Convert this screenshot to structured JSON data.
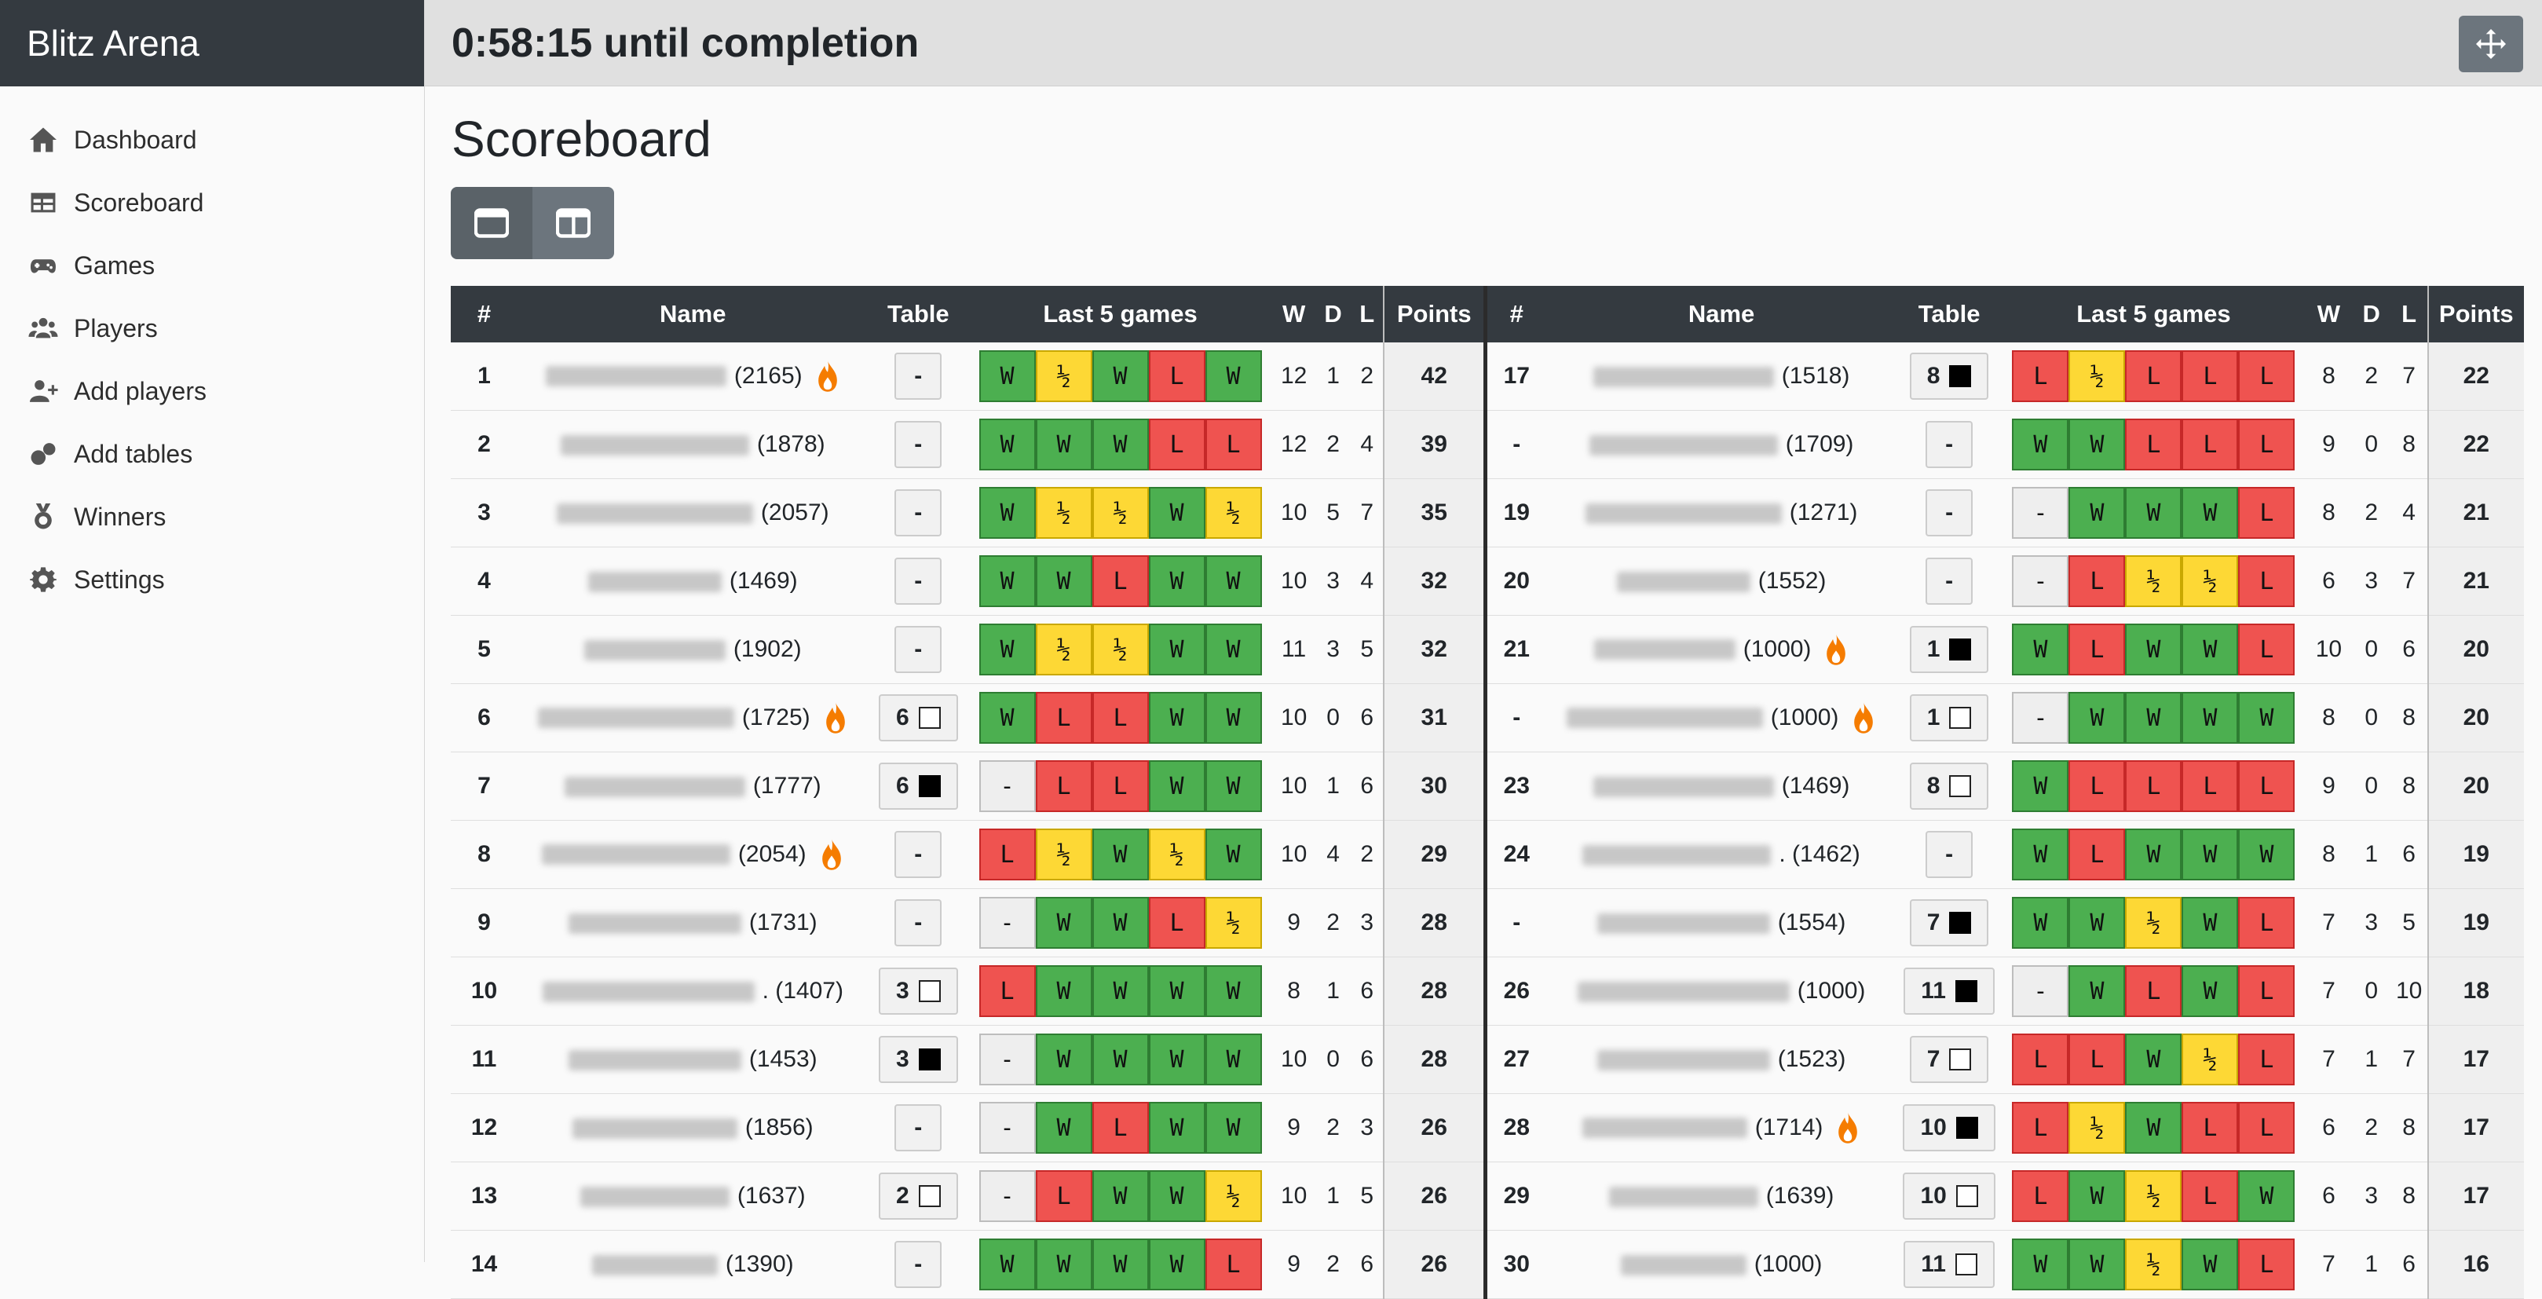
{
  "app": {
    "title": "Blitz Arena"
  },
  "sidebar": {
    "items": [
      {
        "label": "Dashboard",
        "icon": "home-icon"
      },
      {
        "label": "Scoreboard",
        "icon": "table-icon"
      },
      {
        "label": "Games",
        "icon": "gamepad-icon"
      },
      {
        "label": "Players",
        "icon": "users-icon"
      },
      {
        "label": "Add players",
        "icon": "user-plus-icon"
      },
      {
        "label": "Add tables",
        "icon": "tables-icon"
      },
      {
        "label": "Winners",
        "icon": "medal-icon"
      },
      {
        "label": "Settings",
        "icon": "gear-icon"
      }
    ]
  },
  "header": {
    "countdown": "0:58:15 until completion"
  },
  "main": {
    "title": "Scoreboard"
  },
  "columns": {
    "rank": "#",
    "name": "Name",
    "table": "Table",
    "last5": "Last 5 games",
    "w": "W",
    "d": "D",
    "l": "L",
    "points": "Points"
  },
  "colors": {
    "win": "#4caf50",
    "loss": "#ef5350",
    "draw": "#fdd835",
    "none": "#eeeeee",
    "header": "#343a40"
  },
  "standings_left": [
    {
      "rank": "1",
      "elo": "(2165)",
      "fire": true,
      "table": "-",
      "color": "",
      "games": [
        "W",
        "½",
        "W",
        "L",
        "W"
      ],
      "w": "12",
      "d": "1",
      "l": "2",
      "points": "42"
    },
    {
      "rank": "2",
      "elo": "(1878)",
      "fire": false,
      "table": "-",
      "color": "",
      "games": [
        "W",
        "W",
        "W",
        "L",
        "L"
      ],
      "w": "12",
      "d": "2",
      "l": "4",
      "points": "39"
    },
    {
      "rank": "3",
      "elo": "(2057)",
      "fire": false,
      "table": "-",
      "color": "",
      "games": [
        "W",
        "½",
        "½",
        "W",
        "½"
      ],
      "w": "10",
      "d": "5",
      "l": "7",
      "points": "35"
    },
    {
      "rank": "4",
      "elo": "(1469)",
      "fire": false,
      "table": "-",
      "color": "",
      "games": [
        "W",
        "W",
        "L",
        "W",
        "W"
      ],
      "w": "10",
      "d": "3",
      "l": "4",
      "points": "32"
    },
    {
      "rank": "5",
      "elo": "(1902)",
      "fire": false,
      "table": "-",
      "color": "",
      "games": [
        "W",
        "½",
        "½",
        "W",
        "W"
      ],
      "w": "11",
      "d": "3",
      "l": "5",
      "points": "32"
    },
    {
      "rank": "6",
      "elo": "(1725)",
      "fire": true,
      "table": "6",
      "color": "white",
      "games": [
        "W",
        "L",
        "L",
        "W",
        "W"
      ],
      "w": "10",
      "d": "0",
      "l": "6",
      "points": "31"
    },
    {
      "rank": "7",
      "elo": "(1777)",
      "fire": false,
      "table": "6",
      "color": "black",
      "games": [
        "-",
        "L",
        "L",
        "W",
        "W"
      ],
      "w": "10",
      "d": "1",
      "l": "6",
      "points": "30"
    },
    {
      "rank": "8",
      "elo": "(2054)",
      "fire": true,
      "table": "-",
      "color": "",
      "games": [
        "L",
        "½",
        "W",
        "½",
        "W"
      ],
      "w": "10",
      "d": "4",
      "l": "2",
      "points": "29"
    },
    {
      "rank": "9",
      "elo": "(1731)",
      "fire": false,
      "table": "-",
      "color": "",
      "games": [
        "-",
        "W",
        "W",
        "L",
        "½"
      ],
      "w": "9",
      "d": "2",
      "l": "3",
      "points": "28"
    },
    {
      "rank": "10",
      "elo": ". (1407)",
      "fire": false,
      "table": "3",
      "color": "white",
      "games": [
        "L",
        "W",
        "W",
        "W",
        "W"
      ],
      "w": "8",
      "d": "1",
      "l": "6",
      "points": "28"
    },
    {
      "rank": "11",
      "elo": "(1453)",
      "fire": false,
      "table": "3",
      "color": "black",
      "games": [
        "-",
        "W",
        "W",
        "W",
        "W"
      ],
      "w": "10",
      "d": "0",
      "l": "6",
      "points": "28"
    },
    {
      "rank": "12",
      "elo": "(1856)",
      "fire": false,
      "table": "-",
      "color": "",
      "games": [
        "-",
        "W",
        "L",
        "W",
        "W"
      ],
      "w": "9",
      "d": "2",
      "l": "3",
      "points": "26"
    },
    {
      "rank": "13",
      "elo": "(1637)",
      "fire": false,
      "table": "2",
      "color": "white",
      "games": [
        "-",
        "L",
        "W",
        "W",
        "½"
      ],
      "w": "10",
      "d": "1",
      "l": "5",
      "points": "26"
    },
    {
      "rank": "14",
      "elo": "(1390)",
      "fire": false,
      "table": "-",
      "color": "",
      "games": [
        "W",
        "W",
        "W",
        "W",
        "L"
      ],
      "w": "9",
      "d": "2",
      "l": "6",
      "points": "26"
    }
  ],
  "standings_right": [
    {
      "rank": "17",
      "elo": "(1518)",
      "fire": false,
      "table": "8",
      "color": "black",
      "games": [
        "L",
        "½",
        "L",
        "L",
        "L"
      ],
      "w": "8",
      "d": "2",
      "l": "7",
      "points": "22"
    },
    {
      "rank": "-",
      "elo": "(1709)",
      "fire": false,
      "table": "-",
      "color": "",
      "games": [
        "W",
        "W",
        "L",
        "L",
        "L"
      ],
      "w": "9",
      "d": "0",
      "l": "8",
      "points": "22"
    },
    {
      "rank": "19",
      "elo": "(1271)",
      "fire": false,
      "table": "-",
      "color": "",
      "games": [
        "-",
        "W",
        "W",
        "W",
        "L"
      ],
      "w": "8",
      "d": "2",
      "l": "4",
      "points": "21"
    },
    {
      "rank": "20",
      "elo": "(1552)",
      "fire": false,
      "table": "-",
      "color": "",
      "games": [
        "-",
        "L",
        "½",
        "½",
        "L"
      ],
      "w": "6",
      "d": "3",
      "l": "7",
      "points": "21"
    },
    {
      "rank": "21",
      "elo": "(1000)",
      "fire": true,
      "table": "1",
      "color": "black",
      "games": [
        "W",
        "L",
        "W",
        "W",
        "L"
      ],
      "w": "10",
      "d": "0",
      "l": "6",
      "points": "20"
    },
    {
      "rank": "-",
      "elo": "(1000)",
      "fire": true,
      "table": "1",
      "color": "white",
      "games": [
        "-",
        "W",
        "W",
        "W",
        "W"
      ],
      "w": "8",
      "d": "0",
      "l": "8",
      "points": "20"
    },
    {
      "rank": "23",
      "elo": "(1469)",
      "fire": false,
      "table": "8",
      "color": "white",
      "games": [
        "W",
        "L",
        "L",
        "L",
        "L"
      ],
      "w": "9",
      "d": "0",
      "l": "8",
      "points": "20"
    },
    {
      "rank": "24",
      "elo": ". (1462)",
      "fire": false,
      "table": "-",
      "color": "",
      "games": [
        "W",
        "L",
        "W",
        "W",
        "W"
      ],
      "w": "8",
      "d": "1",
      "l": "6",
      "points": "19"
    },
    {
      "rank": "-",
      "elo": "(1554)",
      "fire": false,
      "table": "7",
      "color": "black",
      "games": [
        "W",
        "W",
        "½",
        "W",
        "L"
      ],
      "w": "7",
      "d": "3",
      "l": "5",
      "points": "19"
    },
    {
      "rank": "26",
      "elo": "(1000)",
      "fire": false,
      "table": "11",
      "color": "black",
      "games": [
        "-",
        "W",
        "L",
        "W",
        "L"
      ],
      "w": "7",
      "d": "0",
      "l": "10",
      "points": "18"
    },
    {
      "rank": "27",
      "elo": "(1523)",
      "fire": false,
      "table": "7",
      "color": "white",
      "games": [
        "L",
        "L",
        "W",
        "½",
        "L"
      ],
      "w": "7",
      "d": "1",
      "l": "7",
      "points": "17"
    },
    {
      "rank": "28",
      "elo": "(1714)",
      "fire": true,
      "table": "10",
      "color": "black",
      "games": [
        "L",
        "½",
        "W",
        "L",
        "L"
      ],
      "w": "6",
      "d": "2",
      "l": "8",
      "points": "17"
    },
    {
      "rank": "29",
      "elo": "(1639)",
      "fire": false,
      "table": "10",
      "color": "white",
      "games": [
        "L",
        "W",
        "½",
        "L",
        "W"
      ],
      "w": "6",
      "d": "3",
      "l": "8",
      "points": "17"
    },
    {
      "rank": "30",
      "elo": "(1000)",
      "fire": false,
      "table": "11",
      "color": "white",
      "games": [
        "W",
        "W",
        "½",
        "W",
        "L"
      ],
      "w": "7",
      "d": "1",
      "l": "6",
      "points": "16"
    }
  ]
}
